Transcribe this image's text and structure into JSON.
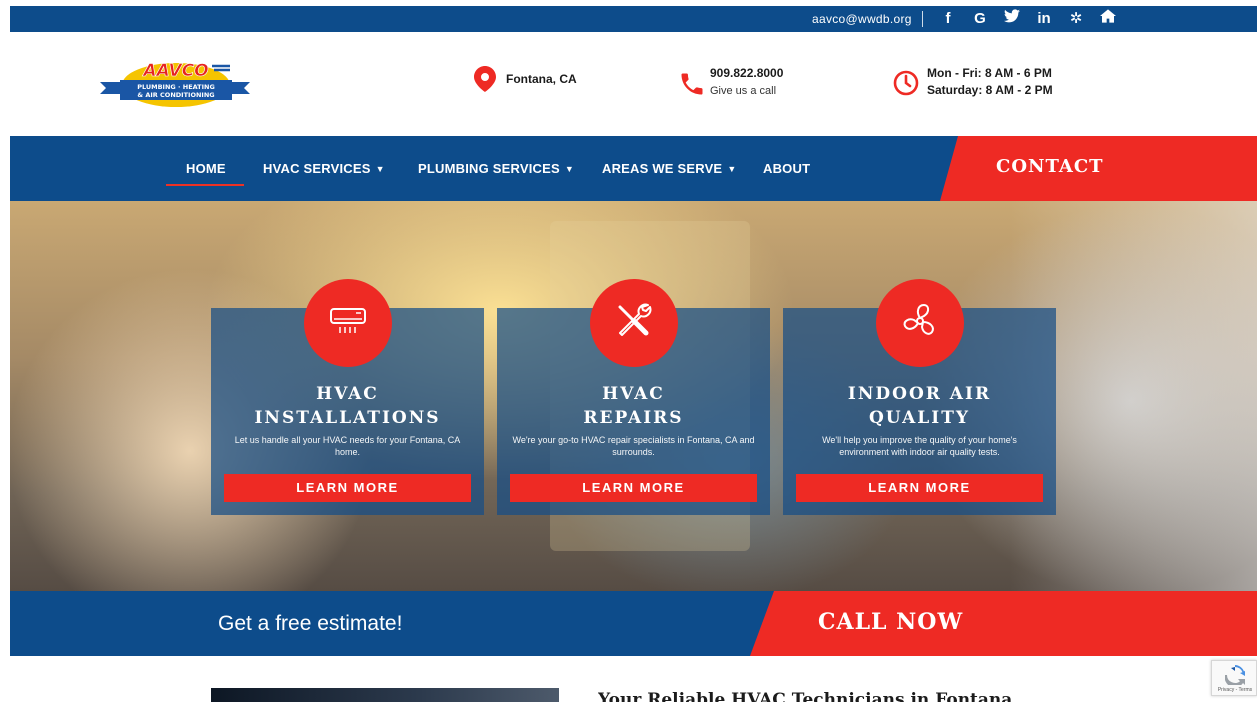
{
  "topbar": {
    "email": "aavco@wwdb.org",
    "social_icons": [
      {
        "name": "facebook-icon",
        "glyph": "f"
      },
      {
        "name": "google-icon",
        "glyph": "G"
      },
      {
        "name": "twitter-icon",
        "glyph": "🐦"
      },
      {
        "name": "linkedin-icon",
        "glyph": "in"
      },
      {
        "name": "yelp-icon",
        "glyph": "✲"
      },
      {
        "name": "home-icon",
        "glyph": "⌂"
      }
    ]
  },
  "header": {
    "logo": {
      "text_main": "AAVCO",
      "text_sub1": "PLUMBING · HEATING",
      "text_sub2": "& AIR CONDITIONING"
    },
    "location": "Fontana, CA",
    "phone": {
      "number": "909.822.8000",
      "sub": "Give us a call"
    },
    "hours": {
      "weekday": "Mon - Fri: 8 AM - 6 PM",
      "saturday": "Saturday: 8 AM - 2 PM"
    }
  },
  "nav": {
    "home": "HOME",
    "hvac": "HVAC SERVICES",
    "plumbing": "PLUMBING SERVICES",
    "areas": "AREAS WE SERVE",
    "about": "ABOUT",
    "contact": "CONTACT",
    "caret": "▼"
  },
  "cards": [
    {
      "title1": "HVAC",
      "title2": "INSTALLATIONS",
      "desc": "Let us handle all your HVAC needs for your Fontana, CA home.",
      "button": "LEARN MORE"
    },
    {
      "title1": "HVAC",
      "title2": "REPAIRS",
      "desc": "We're your go-to HVAC repair specialists in Fontana, CA and surrounds.",
      "button": "LEARN MORE"
    },
    {
      "title1": "INDOOR AIR",
      "title2": "QUALITY",
      "desc": "We'll help you improve the quality of your home's environment with indoor air quality tests.",
      "button": "LEARN MORE"
    }
  ],
  "cta": {
    "left": "Get a free estimate!",
    "right": "CALL NOW"
  },
  "bottom": {
    "heading": "Your Reliable HVAC Technicians in Fontana"
  },
  "recaptcha": {
    "label": "Privacy - Terms"
  },
  "colors": {
    "blue": "#0d4c8b",
    "red": "#ee2a24"
  }
}
